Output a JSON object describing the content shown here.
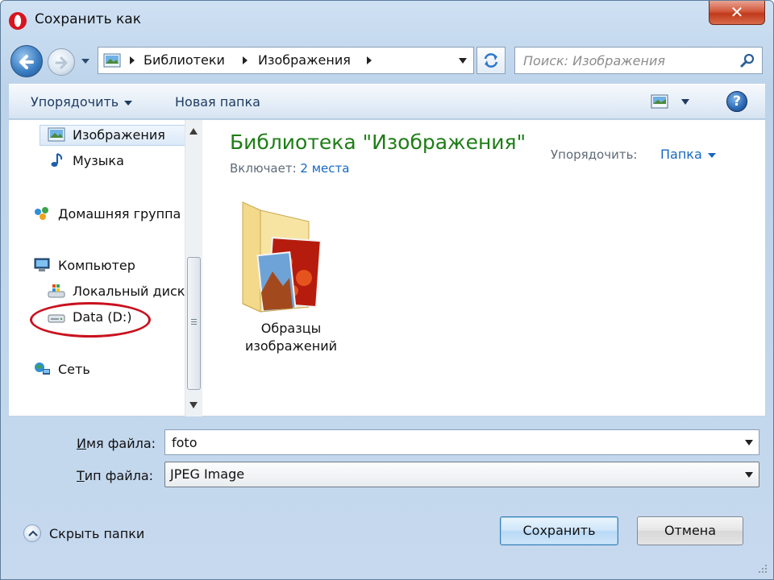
{
  "window": {
    "title": "Сохранить как",
    "close_glyph": "✕"
  },
  "address": {
    "crumbs": [
      "Библиотеки",
      "Изображения"
    ]
  },
  "search": {
    "placeholder": "Поиск: Изображения"
  },
  "toolbar": {
    "organize_label": "Упорядочить",
    "new_folder_label": "Новая папка",
    "help_glyph": "?"
  },
  "nav": {
    "items": [
      {
        "label": "Изображения",
        "icon": "pictures-icon",
        "selected": true
      },
      {
        "label": "Музыка",
        "icon": "music-icon"
      },
      {
        "label": "Домашняя группа",
        "icon": "homegroup-icon"
      },
      {
        "label": "Компьютер",
        "icon": "computer-icon"
      },
      {
        "label": "Локальный диск",
        "icon": "local-disk-icon"
      },
      {
        "label": "Data (D:)",
        "icon": "drive-icon"
      },
      {
        "label": "Сеть",
        "icon": "network-icon"
      }
    ]
  },
  "library": {
    "title": "Библиотека \"Изображения\"",
    "includes_label": "Включает:",
    "includes_link": "2 места",
    "arrange_label": "Упорядочить:",
    "arrange_value": "Папка"
  },
  "files": [
    {
      "name": "Образцы изображений",
      "icon": "pictures-folder-icon"
    }
  ],
  "form": {
    "filename_label_underlined": "И",
    "filename_label_rest": "мя файла:",
    "filename_value": "foto",
    "filetype_label_underlined": "Т",
    "filetype_label_rest": "ип файла:",
    "filetype_value": "JPEG Image"
  },
  "footer": {
    "hide_folders_label": "Скрыть папки",
    "save_label": "Сохранить",
    "cancel_label": "Отмена"
  },
  "colors": {
    "library_title": "#1e7d16",
    "link": "#1667c2",
    "annotation_oval": "#c9111e",
    "close_button": "#c1391b"
  }
}
